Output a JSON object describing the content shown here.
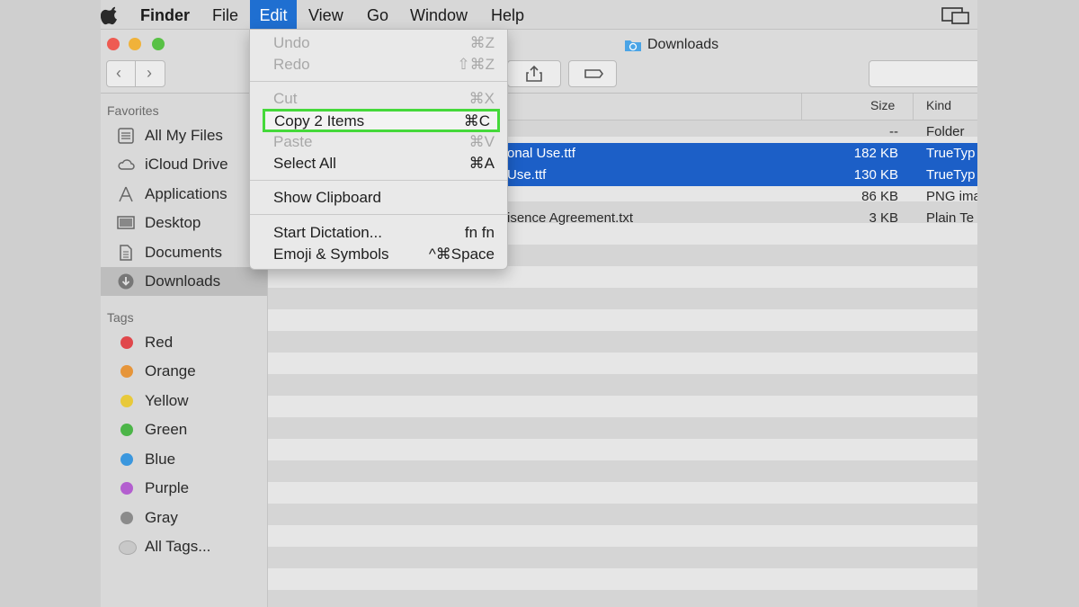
{
  "menubar": {
    "items": [
      "Finder",
      "File",
      "Edit",
      "View",
      "Go",
      "Window",
      "Help"
    ],
    "active": "Edit"
  },
  "window": {
    "title": "Downloads",
    "traffic_colors": [
      "#ee5b52",
      "#f0b23a",
      "#58c145"
    ]
  },
  "sidebar": {
    "favorites_label": "Favorites",
    "favorites": [
      {
        "label": "All My Files",
        "icon": "all-files-icon"
      },
      {
        "label": "iCloud Drive",
        "icon": "cloud-icon"
      },
      {
        "label": "Applications",
        "icon": "applications-icon"
      },
      {
        "label": "Desktop",
        "icon": "desktop-icon"
      },
      {
        "label": "Documents",
        "icon": "documents-icon"
      },
      {
        "label": "Downloads",
        "icon": "downloads-icon",
        "selected": true
      }
    ],
    "tags_label": "Tags",
    "tags": [
      {
        "label": "Red",
        "color": "#e0474b"
      },
      {
        "label": "Orange",
        "color": "#e6953a"
      },
      {
        "label": "Yellow",
        "color": "#e8c93a"
      },
      {
        "label": "Green",
        "color": "#4cb548"
      },
      {
        "label": "Blue",
        "color": "#3b97de"
      },
      {
        "label": "Purple",
        "color": "#b35fcf"
      },
      {
        "label": "Gray",
        "color": "#8b8b8b"
      },
      {
        "label": "All Tags...",
        "color": "#c8c8c8"
      }
    ]
  },
  "filelist": {
    "columns": {
      "size": "Size",
      "kind": "Kind"
    },
    "rows": [
      {
        "name": "",
        "size": "--",
        "kind": "Folder",
        "selected": false
      },
      {
        "name": "onal Use.ttf",
        "size": "182 KB",
        "kind": "TrueTyp",
        "selected": true
      },
      {
        "name": "Use.ttf",
        "size": "130 KB",
        "kind": "TrueTyp",
        "selected": true
      },
      {
        "name": "",
        "size": "86 KB",
        "kind": "PNG ima",
        "selected": false
      },
      {
        "name": "isence Agreement.txt",
        "size": "3 KB",
        "kind": "Plain Te",
        "selected": false
      }
    ]
  },
  "edit_menu": {
    "items": [
      {
        "label": "Undo",
        "key": "⌘Z",
        "disabled": true
      },
      {
        "label": "Redo",
        "key": "⇧⌘Z",
        "disabled": true
      },
      {
        "label": "Cut",
        "key": "⌘X",
        "disabled": true
      },
      {
        "label": "Copy 2 Items",
        "key": "⌘C",
        "disabled": false,
        "highlighted": true
      },
      {
        "label": "Paste",
        "key": "⌘V",
        "disabled": true
      },
      {
        "label": "Select All",
        "key": "⌘A",
        "disabled": false
      },
      {
        "label": "Show Clipboard",
        "key": "",
        "disabled": false
      },
      {
        "label": "Start Dictation...",
        "key": "fn fn",
        "disabled": false
      },
      {
        "label": "Emoji & Symbols",
        "key": "^⌘Space",
        "disabled": false
      }
    ],
    "highlight_color": "#45d93a"
  }
}
